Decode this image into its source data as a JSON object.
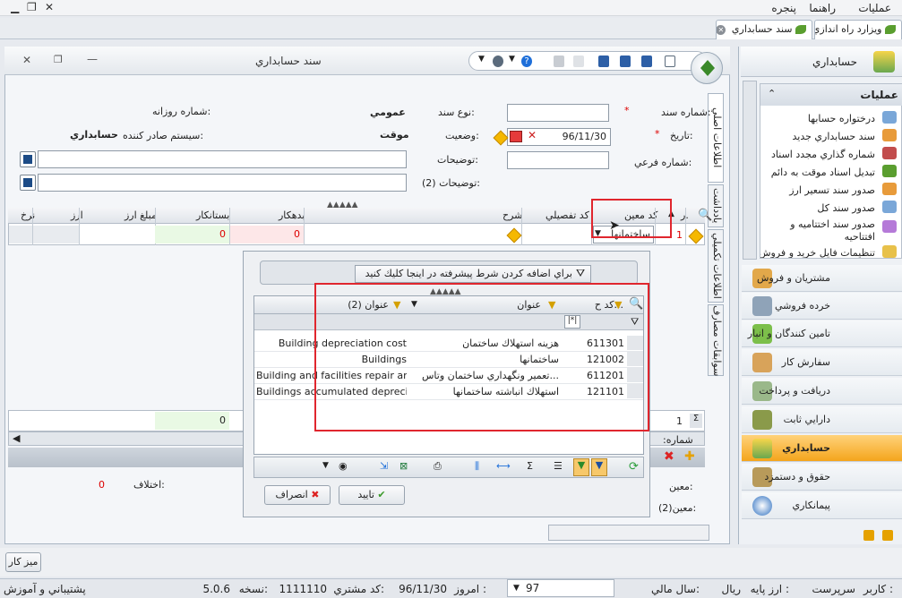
{
  "menubar": {
    "items": [
      "عمليات",
      "راهنما",
      "پنجره"
    ]
  },
  "tabs": [
    {
      "label": "سند حسابداري"
    },
    {
      "label": "ويزارد راه اندازي"
    }
  ],
  "document": {
    "title": "سند حسابداري",
    "fields": {
      "doc_number_label": "شماره  سند:",
      "doc_type_label": "نوع سند:",
      "doc_type_value": "عمومي",
      "daily_number_label": "شماره روزانه:",
      "date_label": "تاريخ:",
      "date_value": "96/11/30",
      "status_label": "وضعيت:",
      "status_value": "موقت",
      "issuer_label": "سيستم صادر كننده:",
      "issuer_value": "حسابداري",
      "sub_number_label": "شماره فرعي:",
      "notes_label": "توضيحات:",
      "notes2_label": "توضيحات (2):",
      "required_mark": "*"
    },
    "grid": {
      "columns": [
        "ر.",
        "كد معين",
        "كد تفصيلي",
        "شرح",
        "بدهكار",
        "بستانكار",
        "مبلغ ارز",
        "ارز",
        "نرخ"
      ],
      "row": {
        "num": "1",
        "account": "ساختمانها",
        "debit": "0",
        "credit": "0"
      },
      "footer": {
        "count": "1",
        "credit_total": "0",
        "number_label": ":شماره"
      }
    },
    "bottom": {
      "difference_label": "اختلاف:",
      "difference_value": "0",
      "moein_label": "معين:",
      "moein2_label": "معين(2):"
    },
    "vertical_tabs": [
      "اطلاعات اصلي",
      "يادداشت",
      "اطلاعات تكميلي",
      "سوابقات مصارف"
    ]
  },
  "popup": {
    "advanced_button": "براي اضافه كردن شرط پيشرفته در اينجا كليك كنيد",
    "columns": [
      "كد ح...",
      "عنوان",
      "عنوان (2)"
    ],
    "rows": [
      {
        "code": "611301",
        "title": "هزينه استهلاك ساختمان",
        "title2": "Building depreciation cost"
      },
      {
        "code": "121002",
        "title": "ساختمانها",
        "title2": "Buildings"
      },
      {
        "code": "611201",
        "title": "تعمير ونگهداري ساختمان وتاس...",
        "title2": "Building and facilities repair and..."
      },
      {
        "code": "121101",
        "title": "استهلاك انباشته ساختمانها",
        "title2": "Buildings accumulated deprecia..."
      }
    ],
    "confirm_button": "تاييد",
    "cancel_button": "انصراف"
  },
  "right_panel": {
    "title": "حسابداري",
    "tasks_header": "عمليات",
    "tasks": [
      "درختواره حسابها",
      "سند حسابداري جديد",
      "شماره گذاري مجدد اسناد",
      "تبديل اسناد موقت به دائم",
      "صدور سند تسعير ارز",
      "صدور سند كل",
      "صدور سند اختتاميه و افتتاحيه",
      "تنظيمات فايل خريد و فروش"
    ],
    "modules": [
      {
        "label": "مشتريان و فروش",
        "active": false
      },
      {
        "label": "خرده فروشي",
        "active": false
      },
      {
        "label": "تامين كنندگان و انبار",
        "active": false
      },
      {
        "label": "سفارش كار",
        "active": false
      },
      {
        "label": "دريافت و پرداخت",
        "active": false
      },
      {
        "label": "دارايي ثابت",
        "active": false
      },
      {
        "label": "حسابداري",
        "active": true
      },
      {
        "label": "حقوق و دستمزد",
        "active": false
      },
      {
        "label": "پيمانكاري",
        "active": false
      }
    ]
  },
  "taskbar": {
    "desk_button": "ميز كار"
  },
  "statusbar": {
    "user_label": "كاربر :",
    "user_value": "سرپرست",
    "base_currency_label": "ارز پايه :",
    "base_currency_value": "ريال",
    "fiscal_year_label": "سال مالي:",
    "fiscal_year_value": "97",
    "today_label": "امروز :",
    "today_value": "96/11/30",
    "customer_code_label": "كد مشتري:",
    "customer_code_value": "1111110",
    "version_label": "نسخه:",
    "version_value": "5.0.6",
    "support_label": "پشتيباني و آموزش"
  },
  "colors": {
    "accent": "#f4a51c",
    "highlight_box": "#e0262e",
    "green": "#5a9e2f"
  }
}
